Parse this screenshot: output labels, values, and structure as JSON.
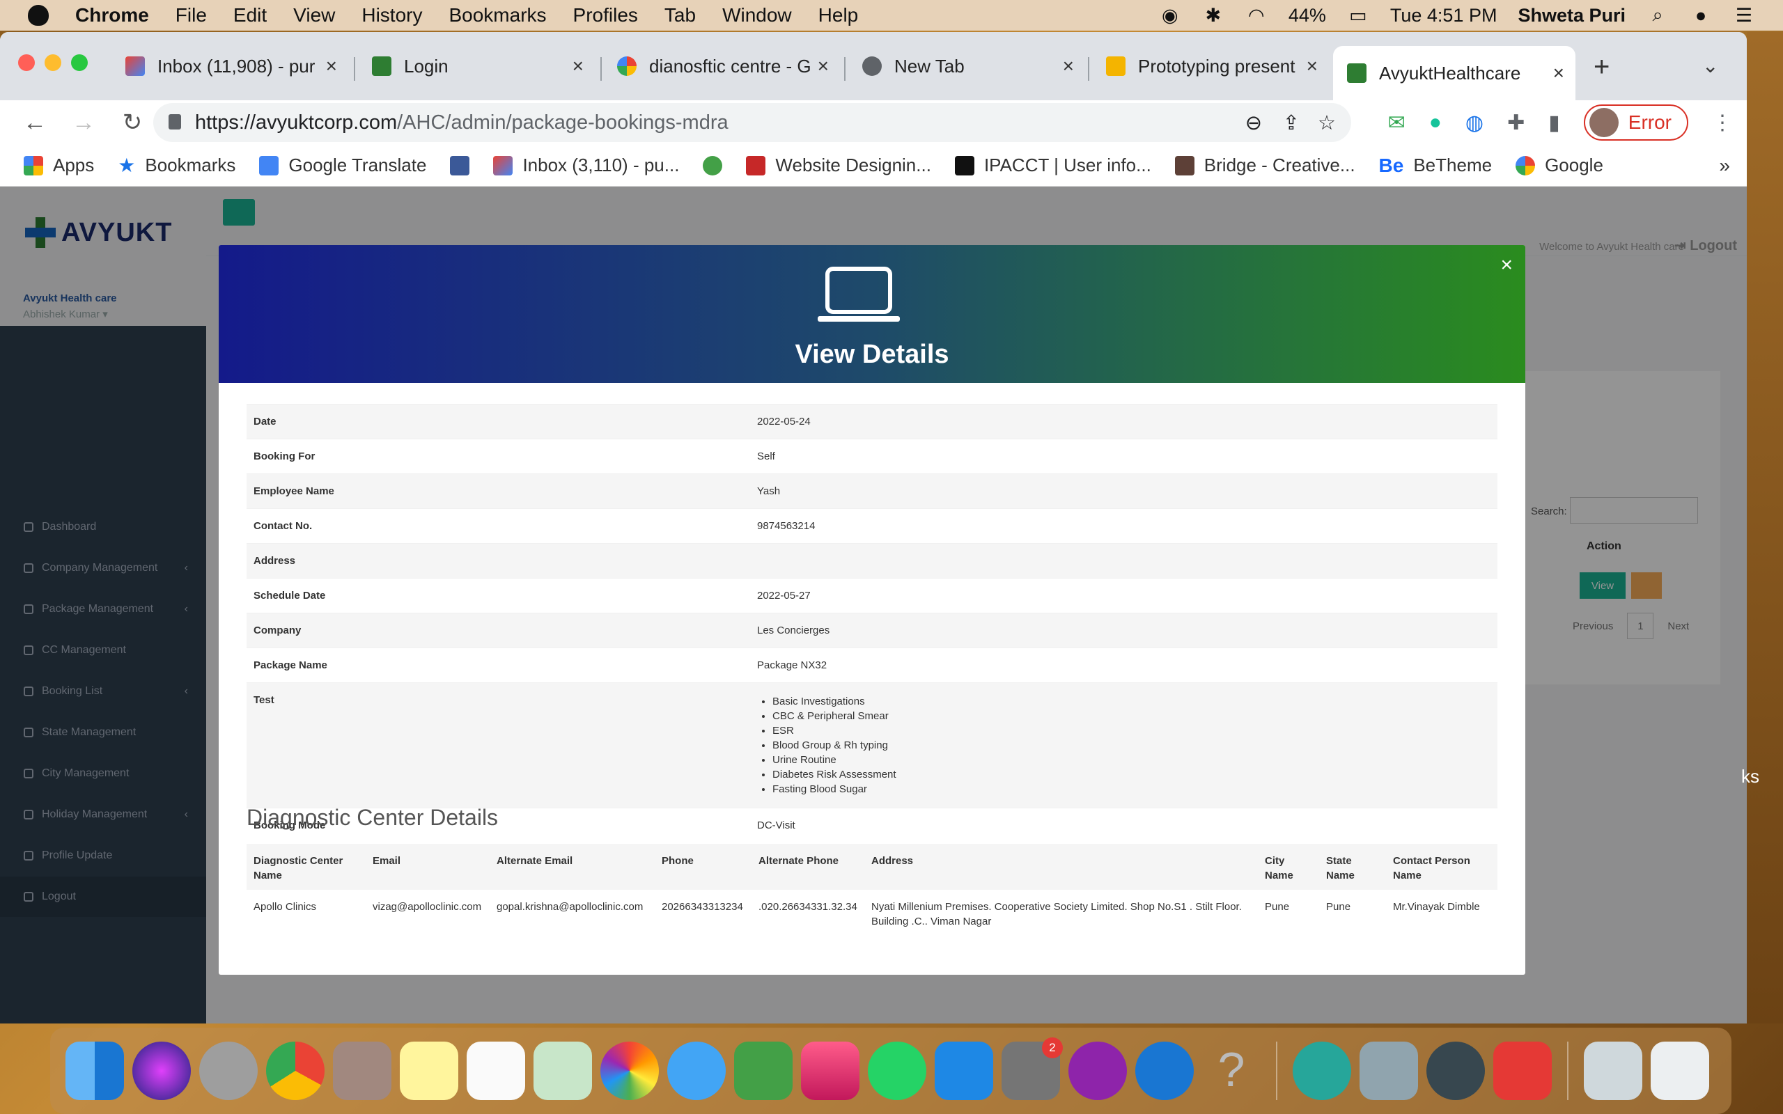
{
  "menubar": {
    "app": "Chrome",
    "items": [
      "File",
      "Edit",
      "View",
      "History",
      "Bookmarks",
      "Profiles",
      "Tab",
      "Window",
      "Help"
    ],
    "battery": "44%",
    "clock": "Tue 4:51 PM",
    "user": "Shweta Puri"
  },
  "tabs": [
    {
      "label": "Inbox (11,908) - pur",
      "icon": "gmail-icon"
    },
    {
      "label": "Login",
      "icon": "avyukt-icon"
    },
    {
      "label": "dianosftic centre - G",
      "icon": "google-icon"
    },
    {
      "label": "New Tab",
      "icon": "chrome-icon"
    },
    {
      "label": "Prototyping present",
      "icon": "slides-icon"
    },
    {
      "label": "AvyuktHealthcare",
      "icon": "avyukt-icon"
    }
  ],
  "address": {
    "host": "https://avyuktcorp.com",
    "path": "/AHC/admin/package-bookings-mdra"
  },
  "profile_status": "Error",
  "bookmarks": [
    "Apps",
    "Bookmarks",
    "Google Translate",
    "",
    "Inbox (3,110) - pu...",
    "",
    "Website Designin...",
    "IPACCT | User info...",
    "Bridge - Creative...",
    "BeTheme",
    "Google"
  ],
  "bookmarks_more": "»",
  "sidebar": {
    "logo": "AVYUKT",
    "org": "Avyukt Health care",
    "user": "Abhishek Kumar",
    "items": [
      {
        "label": "Dashboard",
        "arrow": ""
      },
      {
        "label": "Company Management",
        "arrow": "‹"
      },
      {
        "label": "Package Management",
        "arrow": "‹"
      },
      {
        "label": "CC Management",
        "arrow": ""
      },
      {
        "label": "Booking List",
        "arrow": "‹"
      },
      {
        "label": "State Management",
        "arrow": ""
      },
      {
        "label": "City Management",
        "arrow": ""
      },
      {
        "label": "Holiday Management",
        "arrow": "‹"
      },
      {
        "label": "Profile Update",
        "arrow": ""
      },
      {
        "label": "Logout",
        "arrow": ""
      }
    ]
  },
  "topbar": {
    "welcome": "Welcome to Avyukt Health care",
    "logout": "Logout"
  },
  "background_table": {
    "search_label": "Search:",
    "action_header": "Action",
    "view_button": "View",
    "prev": "Previous",
    "page": "1",
    "next": "Next"
  },
  "modal": {
    "title": "View Details",
    "close": "×",
    "details": [
      {
        "key": "Date",
        "value": "2022-05-24"
      },
      {
        "key": "Booking For",
        "value": "Self"
      },
      {
        "key": "Employee Name",
        "value": "Yash"
      },
      {
        "key": "Contact No.",
        "value": "9874563214"
      },
      {
        "key": "Address",
        "value": ""
      },
      {
        "key": "Schedule Date",
        "value": "2022-05-27"
      },
      {
        "key": "Company",
        "value": "Les Concierges"
      },
      {
        "key": "Package Name",
        "value": "Package NX32"
      }
    ],
    "test_label": "Test",
    "tests": [
      "Basic Investigations",
      "CBC & Peripheral Smear",
      "ESR",
      "Blood Group & Rh typing",
      "Urine Routine",
      "Diabetes Risk Assessment",
      "Fasting Blood Sugar"
    ],
    "booking_mode_label": "Booking Mode",
    "booking_mode": "DC-Visit",
    "dc_heading": "Diagnostic Center Details",
    "dc_headers": [
      "Diagnostic Center Name",
      "Email",
      "Alternate Email",
      "Phone",
      "Alternate Phone",
      "Address",
      "City Name",
      "State Name",
      "Contact Person Name"
    ],
    "dc_row": [
      "Apollo Clinics",
      "vizag@apolloclinic.com",
      "gopal.krishna@apolloclinic.com",
      "20266343313234",
      ".020.26634331.32.34",
      "Nyati Millenium Premises. Cooperative Society Limited. Shop No.S1 . Stilt Floor. Building .C.. Viman Nagar",
      "Pune",
      "Pune",
      "Mr.Vinayak Dimble"
    ]
  },
  "dock": {
    "settings_badge": "2"
  },
  "colors": {
    "accent_green": "#1ab394",
    "header_left": "#141a8a",
    "header_right": "#2a8c1e"
  }
}
